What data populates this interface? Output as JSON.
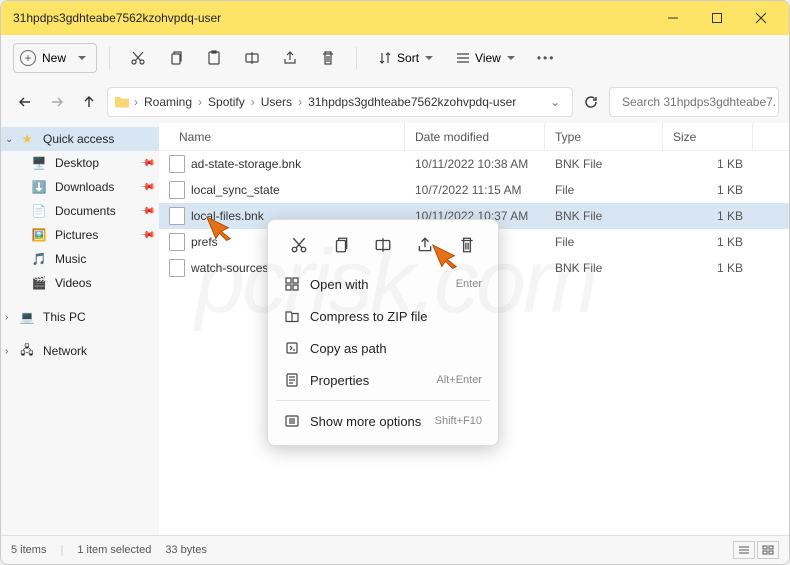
{
  "window": {
    "title": "31hpdps3gdhteabe7562kzohvpdq-user"
  },
  "toolbar": {
    "new_label": "New",
    "sort_label": "Sort",
    "view_label": "View"
  },
  "breadcrumb": {
    "items": [
      "Roaming",
      "Spotify",
      "Users",
      "31hpdps3gdhteabe7562kzohvpdq-user"
    ]
  },
  "search": {
    "placeholder": "Search 31hpdps3gdhteabe7..."
  },
  "sidebar": {
    "quick_access": "Quick access",
    "items": [
      {
        "label": "Desktop",
        "pinned": true
      },
      {
        "label": "Downloads",
        "pinned": true
      },
      {
        "label": "Documents",
        "pinned": true
      },
      {
        "label": "Pictures",
        "pinned": true
      },
      {
        "label": "Music",
        "pinned": false
      },
      {
        "label": "Videos",
        "pinned": false
      }
    ],
    "this_pc": "This PC",
    "network": "Network"
  },
  "columns": {
    "name": "Name",
    "date": "Date modified",
    "type": "Type",
    "size": "Size"
  },
  "files": [
    {
      "name": "ad-state-storage.bnk",
      "date": "10/11/2022 10:38 AM",
      "type": "BNK File",
      "size": "1 KB",
      "selected": false
    },
    {
      "name": "local_sync_state",
      "date": "10/7/2022 11:15 AM",
      "type": "File",
      "size": "1 KB",
      "selected": false
    },
    {
      "name": "local-files.bnk",
      "date": "10/11/2022 10:37 AM",
      "type": "BNK File",
      "size": "1 KB",
      "selected": true
    },
    {
      "name": "prefs",
      "date": "7 AM",
      "type": "File",
      "size": "1 KB",
      "selected": false
    },
    {
      "name": "watch-sources.bn",
      "date": "7 AM",
      "type": "BNK File",
      "size": "1 KB",
      "selected": false
    }
  ],
  "context_menu": {
    "open_with": "Open with",
    "compress": "Compress to ZIP file",
    "copy_path": "Copy as path",
    "properties": "Properties",
    "properties_short": "Alt+Enter",
    "show_more": "Show more options",
    "show_more_short": "Shift+F10",
    "enter": "Enter"
  },
  "status": {
    "count": "5 items",
    "selected": "1 item selected",
    "size": "33 bytes"
  },
  "watermark": "pcrisk.com"
}
